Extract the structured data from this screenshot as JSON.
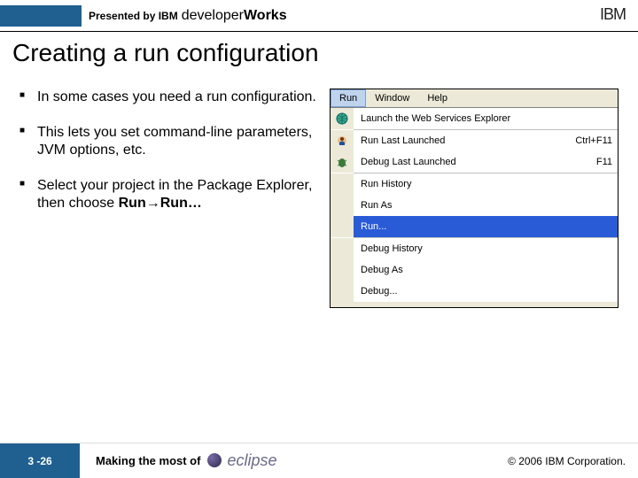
{
  "header": {
    "presented": "Presented by IBM",
    "brand1": "developer",
    "brand2": "Works",
    "logo": "IBM"
  },
  "title": "Creating a run configuration",
  "bullets": [
    {
      "text": "In some cases you need a run configuration."
    },
    {
      "text": "This lets you set command-line parameters, JVM options, etc."
    },
    {
      "prefix": "Select your project in the Package Explorer, then choose ",
      "bold1": "Run",
      "arrow": "→",
      "bold2": "Run…"
    }
  ],
  "menu": {
    "bar": {
      "run": "Run",
      "window": "Window",
      "help": "Help"
    },
    "items": {
      "launch_wse": "Launch the Web Services Explorer",
      "run_last": "Run Last Launched",
      "run_last_key": "Ctrl+F11",
      "debug_last": "Debug Last Launched",
      "debug_last_key": "F11",
      "run_history": "Run History",
      "run_as": "Run As",
      "run": "Run...",
      "debug_history": "Debug History",
      "debug_as": "Debug As",
      "debug": "Debug..."
    }
  },
  "footer": {
    "page": "3 -26",
    "subtitle": "Making the most of",
    "product": "eclipse",
    "copyright": "© 2006 IBM Corporation."
  }
}
